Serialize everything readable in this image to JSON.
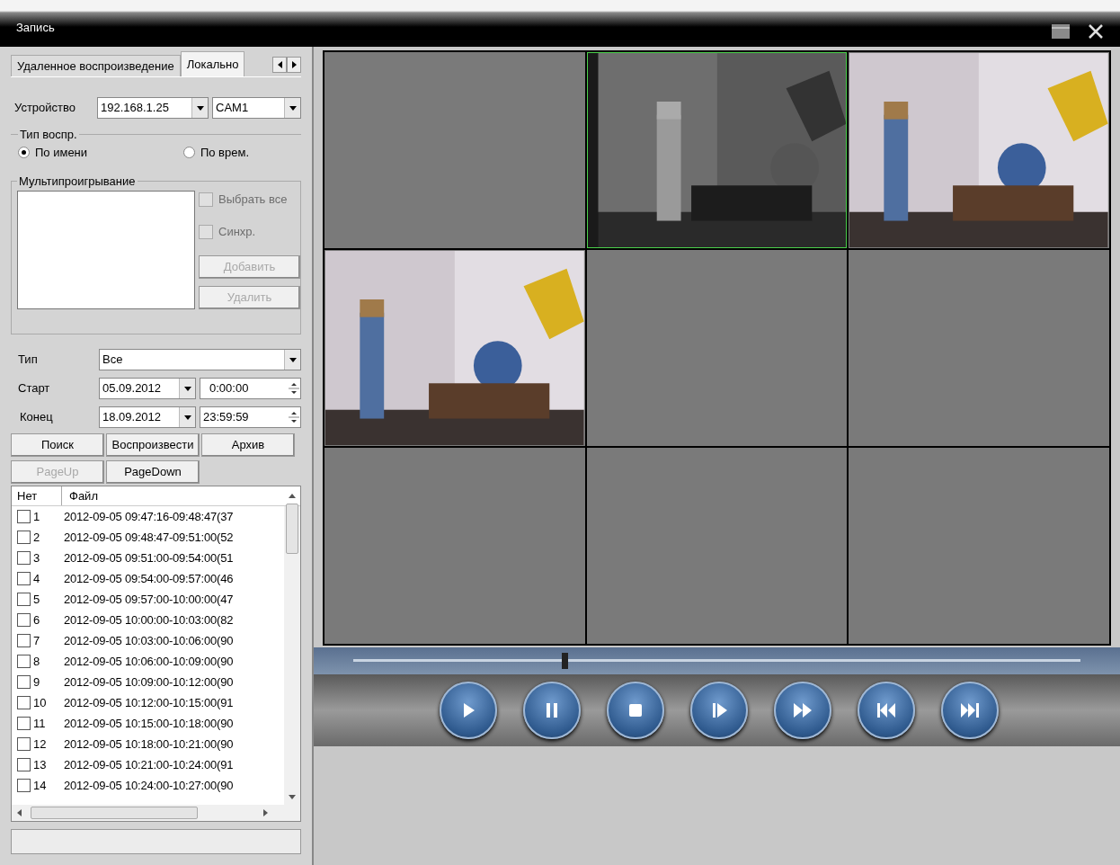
{
  "window": {
    "title": "Запись"
  },
  "tabs": [
    {
      "label": "Удаленное воспроизведение",
      "selected": false
    },
    {
      "label": "Локально",
      "selected": true
    }
  ],
  "device": {
    "label": "Устройство",
    "address": "192.168.1.25",
    "channel": "CAM1"
  },
  "play_type": {
    "title": "Тип воспр.",
    "options": [
      {
        "label": "По имени",
        "selected": true
      },
      {
        "label": "По врем.",
        "selected": false
      }
    ]
  },
  "multiplay": {
    "title": "Мультипроигрывание",
    "checks": [
      {
        "label": "Выбрать все",
        "checked": false,
        "disabled": true
      },
      {
        "label": "Синхр.",
        "checked": false,
        "disabled": true
      }
    ],
    "buttons": [
      {
        "label": "Добавить",
        "disabled": true
      },
      {
        "label": "Удалить",
        "disabled": true
      }
    ]
  },
  "filters": {
    "type_label": "Тип",
    "type_value": "Все",
    "start_label": "Старт",
    "start_date": "05.09.2012",
    "start_time": "0:00:00",
    "end_label": "Конец",
    "end_date": "18.09.2012",
    "end_time": "23:59:59"
  },
  "actions": [
    {
      "label": "Поиск",
      "disabled": false
    },
    {
      "label": "Воспроизвести",
      "disabled": false
    },
    {
      "label": "Архив",
      "disabled": false
    }
  ],
  "paging": [
    {
      "label": "PageUp",
      "disabled": true
    },
    {
      "label": "PageDown",
      "disabled": false
    }
  ],
  "files": {
    "columns": [
      "Нет",
      "Файл"
    ],
    "rows": [
      {
        "no": "1",
        "file": "2012-09-05 09:47:16-09:48:47(37",
        "checked": false
      },
      {
        "no": "2",
        "file": "2012-09-05 09:48:47-09:51:00(52",
        "checked": false
      },
      {
        "no": "3",
        "file": "2012-09-05 09:51:00-09:54:00(51",
        "checked": false
      },
      {
        "no": "4",
        "file": "2012-09-05 09:54:00-09:57:00(46",
        "checked": false
      },
      {
        "no": "5",
        "file": "2012-09-05 09:57:00-10:00:00(47",
        "checked": false
      },
      {
        "no": "6",
        "file": "2012-09-05 10:00:00-10:03:00(82",
        "checked": false
      },
      {
        "no": "7",
        "file": "2012-09-05 10:03:00-10:06:00(90",
        "checked": false
      },
      {
        "no": "8",
        "file": "2012-09-05 10:06:00-10:09:00(90",
        "checked": false
      },
      {
        "no": "9",
        "file": "2012-09-05 10:09:00-10:12:00(90",
        "checked": false
      },
      {
        "no": "10",
        "file": "2012-09-05 10:12:00-10:15:00(91",
        "checked": false
      },
      {
        "no": "11",
        "file": "2012-09-05 10:15:00-10:18:00(90",
        "checked": false
      },
      {
        "no": "12",
        "file": "2012-09-05 10:18:00-10:21:00(90",
        "checked": false
      },
      {
        "no": "13",
        "file": "2012-09-05 10:21:00-10:24:00(91",
        "checked": false
      },
      {
        "no": "14",
        "file": "2012-09-05 10:24:00-10:27:00(90",
        "checked": false
      }
    ]
  },
  "cells": [
    {
      "kind": "empty",
      "selected": false
    },
    {
      "kind": "picture",
      "selected": true
    },
    {
      "kind": "picture",
      "selected": false
    },
    {
      "kind": "picture",
      "selected": false
    },
    {
      "kind": "empty",
      "selected": false
    },
    {
      "kind": "empty",
      "selected": false
    },
    {
      "kind": "empty",
      "selected": false
    },
    {
      "kind": "empty",
      "selected": false
    },
    {
      "kind": "empty",
      "selected": false
    }
  ],
  "timeline": {
    "level": 0.29
  }
}
